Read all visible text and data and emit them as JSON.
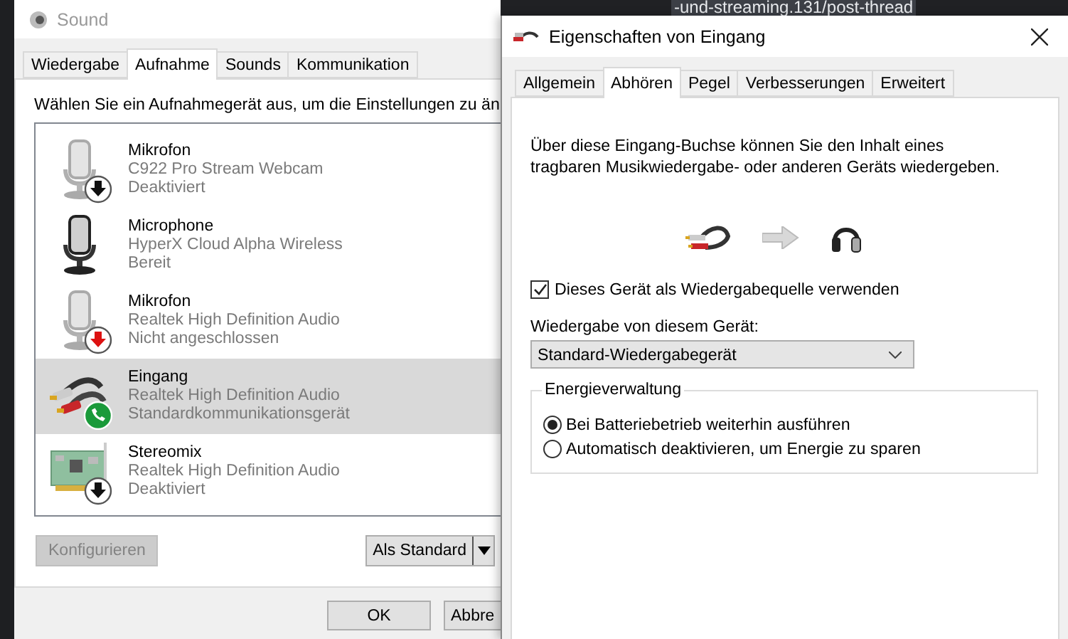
{
  "browser": {
    "address_fragment": "-und-streaming.131/post-thread"
  },
  "sound_window": {
    "title": "Sound",
    "tabs": [
      {
        "label": "Wiedergabe",
        "selected": false
      },
      {
        "label": "Aufnahme",
        "selected": true
      },
      {
        "label": "Sounds",
        "selected": false
      },
      {
        "label": "Kommunikation",
        "selected": false
      }
    ],
    "instruction": "Wählen Sie ein Aufnahmegerät aus, um die Einstellungen zu än",
    "devices": [
      {
        "kind": "webcam-mic",
        "disabled": true,
        "unplugged": false,
        "default_communication": false,
        "name": "Mikrofon",
        "description": "C922 Pro Stream Webcam",
        "status": "Deaktiviert",
        "selected": false
      },
      {
        "kind": "headset-mic",
        "disabled": false,
        "unplugged": false,
        "default_communication": false,
        "name": "Microphone",
        "description": "HyperX Cloud Alpha Wireless",
        "status": "Bereit",
        "selected": false
      },
      {
        "kind": "mic",
        "disabled": false,
        "unplugged": true,
        "default_communication": false,
        "name": "Mikrofon",
        "description": "Realtek High Definition Audio",
        "status": "Nicht angeschlossen",
        "selected": false
      },
      {
        "kind": "line-in",
        "disabled": false,
        "unplugged": false,
        "default_communication": true,
        "name": "Eingang",
        "description": "Realtek High Definition Audio",
        "status": "Standardkommunikationsgerät",
        "selected": true
      },
      {
        "kind": "card",
        "disabled": true,
        "unplugged": false,
        "default_communication": false,
        "name": "Stereomix",
        "description": "Realtek High Definition Audio",
        "status": "Deaktiviert",
        "selected": false
      }
    ],
    "configure": {
      "label": "Konfigurieren",
      "disabled": true
    },
    "set_default": {
      "label": "Als Standard"
    },
    "ok": {
      "label": "OK"
    },
    "cancel": {
      "label": "Abbre"
    }
  },
  "properties_dialog": {
    "title": "Eigenschaften von Eingang",
    "tabs": [
      {
        "label": "Allgemein",
        "selected": false
      },
      {
        "label": "Abhören",
        "selected": true
      },
      {
        "label": "Pegel",
        "selected": false
      },
      {
        "label": "Verbesserungen",
        "selected": false
      },
      {
        "label": "Erweitert",
        "selected": false
      }
    ],
    "description": "Über diese Eingang-Buchse können Sie den Inhalt eines tragbaren Musikwiedergabe- oder anderen Geräts wiedergeben.",
    "listen_checkbox": {
      "label": "Dieses Gerät als Wiedergabequelle verwenden",
      "checked": true
    },
    "playback_label": "Wiedergabe von diesem Gerät:",
    "playback_device": {
      "value": "Standard-Wiedergabegerät"
    },
    "power": {
      "title": "Energieverwaltung",
      "options": [
        {
          "label": "Bei Batteriebetrieb weiterhin ausführen",
          "selected": true
        },
        {
          "label": "Automatisch deaktivieren, um Energie zu sparen",
          "selected": false
        }
      ]
    }
  }
}
